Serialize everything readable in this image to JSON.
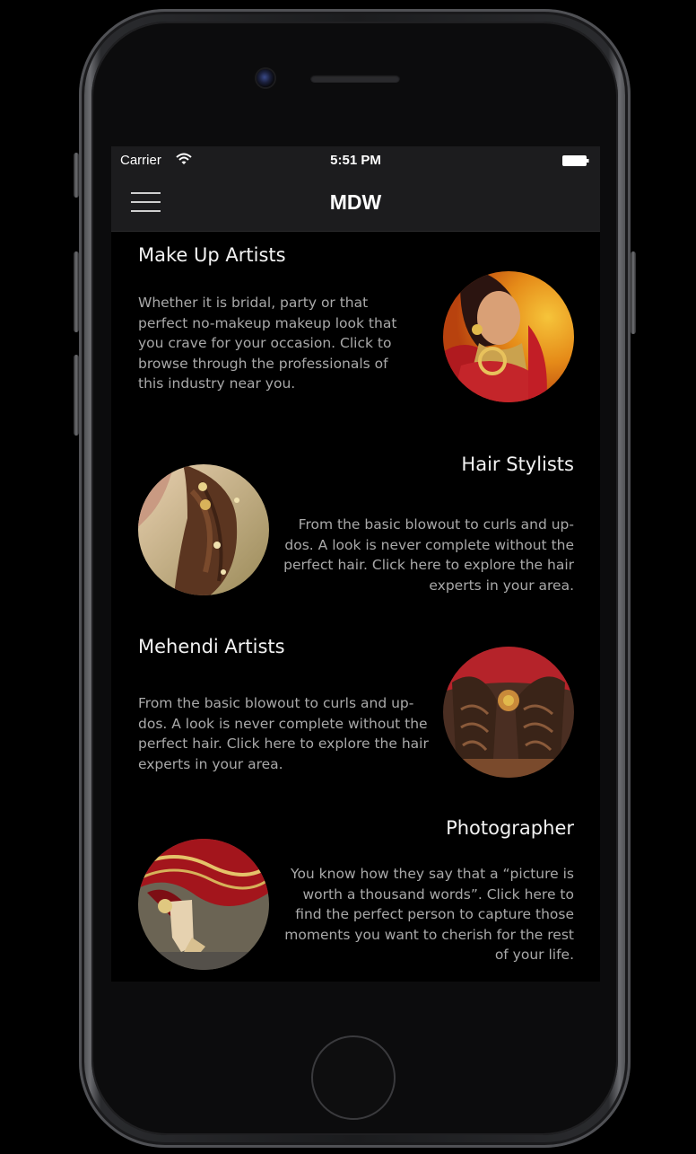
{
  "status_bar": {
    "carrier": "Carrier",
    "time": "5:51 PM",
    "wifi_icon": "wifi-icon",
    "battery_icon": "battery-icon"
  },
  "nav_bar": {
    "title": "MDW",
    "menu_icon": "hamburger-menu-icon"
  },
  "sections": [
    {
      "title": "Make Up Artists",
      "description": "Whether it is bridal, party or that perfect no-makeup makeup look that you crave for your occasion. Click to browse through the professionals of this industry near you.",
      "image": "bride-makeup-photo"
    },
    {
      "title": "Hair Stylists",
      "description": "From the basic blowout to curls and up-dos. A look is never complete without the perfect hair. Click here to explore the hair experts in your area.",
      "image": "bridal-hairstyle-photo"
    },
    {
      "title": "Mehendi Artists",
      "description": "From the basic blowout to curls and up-dos. A look is never complete without the perfect hair. Click here to explore the hair experts in your area.",
      "image": "mehendi-hands-photo"
    },
    {
      "title": "Photographer",
      "description": "You know how they say that a “picture is worth a thousand words”. Click here to find the perfect person to capture those moments you want to cherish for the rest of your life.",
      "image": "bridal-shoes-photo"
    }
  ],
  "colors": {
    "background": "#000000",
    "bar": "#1c1c1e",
    "title_text": "#f2f2f2",
    "body_text": "#a9a9a9"
  }
}
